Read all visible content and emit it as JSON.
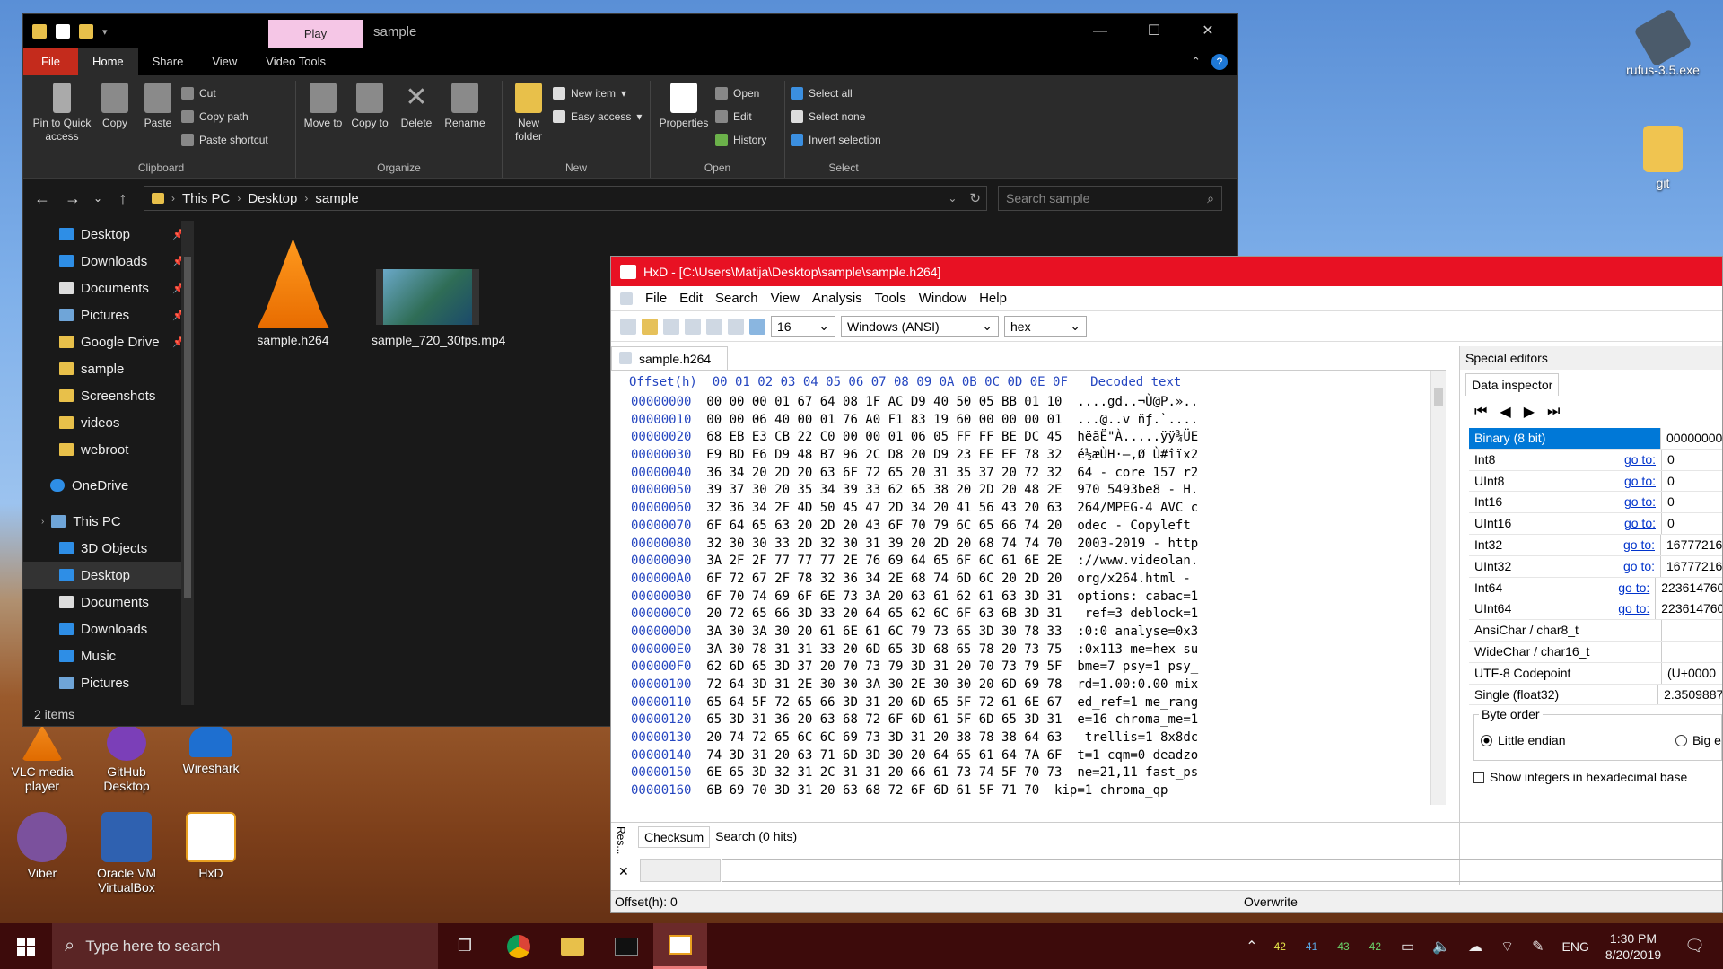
{
  "desktop": {
    "icons_left": [
      {
        "label": "VLC media player"
      },
      {
        "label": "GitHub Desktop"
      },
      {
        "label": "Wireshark"
      },
      {
        "label": "Viber"
      },
      {
        "label": "Oracle VM VirtualBox"
      },
      {
        "label": "HxD"
      }
    ],
    "icons_right": [
      {
        "label": "rufus-3.5.exe"
      },
      {
        "label": "git"
      }
    ]
  },
  "explorer": {
    "contextual_tab": "Play",
    "title": "sample",
    "tabs": [
      "File",
      "Home",
      "Share",
      "View",
      "Video Tools"
    ],
    "ribbon": {
      "clipboard": {
        "label": "Clipboard",
        "pin": "Pin to Quick access",
        "copy": "Copy",
        "paste": "Paste",
        "cut": "Cut",
        "copy_path": "Copy path",
        "paste_shortcut": "Paste shortcut"
      },
      "organize": {
        "label": "Organize",
        "move_to": "Move to",
        "copy_to": "Copy to",
        "delete": "Delete",
        "rename": "Rename"
      },
      "new": {
        "label": "New",
        "new_folder": "New folder",
        "new_item": "New item",
        "easy_access": "Easy access"
      },
      "open": {
        "label": "Open",
        "properties": "Properties",
        "open": "Open",
        "edit": "Edit",
        "history": "History"
      },
      "select": {
        "label": "Select",
        "select_all": "Select all",
        "select_none": "Select none",
        "invert": "Invert selection"
      }
    },
    "breadcrumb": [
      "This PC",
      "Desktop",
      "sample"
    ],
    "search_placeholder": "Search sample",
    "nav_items": [
      {
        "label": "Desktop",
        "pinned": true
      },
      {
        "label": "Downloads",
        "pinned": true
      },
      {
        "label": "Documents",
        "pinned": true
      },
      {
        "label": "Pictures",
        "pinned": true
      },
      {
        "label": "Google Drive",
        "pinned": true
      },
      {
        "label": "sample"
      },
      {
        "label": "Screenshots"
      },
      {
        "label": "videos"
      },
      {
        "label": "webroot"
      },
      {
        "label": "OneDrive"
      },
      {
        "label": "This PC"
      },
      {
        "label": "3D Objects"
      },
      {
        "label": "Desktop"
      },
      {
        "label": "Documents"
      },
      {
        "label": "Downloads"
      },
      {
        "label": "Music"
      },
      {
        "label": "Pictures"
      }
    ],
    "files": [
      {
        "name": "sample.h264"
      },
      {
        "name": "sample_720_30fps.mp4"
      }
    ],
    "status": "2 items"
  },
  "hxd": {
    "title": "HxD - [C:\\Users\\Matija\\Desktop\\sample\\sample.h264]",
    "menu": [
      "File",
      "Edit",
      "Search",
      "View",
      "Analysis",
      "Tools",
      "Window",
      "Help"
    ],
    "bytes_per_row": "16",
    "charset": "Windows (ANSI)",
    "display": "hex",
    "doc_tab": "sample.h264",
    "header_offset": "Offset(h)",
    "header_cols": "00 01 02 03 04 05 06 07 08 09 0A 0B 0C 0D 0E 0F",
    "header_decoded": "Decoded text",
    "rows": [
      {
        "off": "00000000",
        "hex": "00 00 00 01 67 64 08 1F AC D9 40 50 05 BB 01 10",
        "txt": "....gd..¬Ù@P.».."
      },
      {
        "off": "00000010",
        "hex": "00 00 06 40 00 01 76 A0 F1 83 19 60 00 00 00 01",
        "txt": "...@..v ñƒ.`...."
      },
      {
        "off": "00000020",
        "hex": "68 EB E3 CB 22 C0 00 00 01 06 05 FF FF BE DC 45",
        "txt": "hëãË\"À.....ÿÿ¾ÜE"
      },
      {
        "off": "00000030",
        "hex": "E9 BD E6 D9 48 B7 96 2C D8 20 D9 23 EE EF 78 32",
        "txt": "é½æÙH·–,Ø Ù#îïx2"
      },
      {
        "off": "00000040",
        "hex": "36 34 20 2D 20 63 6F 72 65 20 31 35 37 20 72 32",
        "txt": "64 - core 157 r2"
      },
      {
        "off": "00000050",
        "hex": "39 37 30 20 35 34 39 33 62 65 38 20 2D 20 48 2E",
        "txt": "970 5493be8 - H."
      },
      {
        "off": "00000060",
        "hex": "32 36 34 2F 4D 50 45 47 2D 34 20 41 56 43 20 63",
        "txt": "264/MPEG-4 AVC c"
      },
      {
        "off": "00000070",
        "hex": "6F 64 65 63 20 2D 20 43 6F 70 79 6C 65 66 74 20",
        "txt": "odec - Copyleft "
      },
      {
        "off": "00000080",
        "hex": "32 30 30 33 2D 32 30 31 39 20 2D 20 68 74 74 70",
        "txt": "2003-2019 - http"
      },
      {
        "off": "00000090",
        "hex": "3A 2F 2F 77 77 77 2E 76 69 64 65 6F 6C 61 6E 2E",
        "txt": "://www.videolan."
      },
      {
        "off": "000000A0",
        "hex": "6F 72 67 2F 78 32 36 34 2E 68 74 6D 6C 20 2D 20",
        "txt": "org/x264.html - "
      },
      {
        "off": "000000B0",
        "hex": "6F 70 74 69 6F 6E 73 3A 20 63 61 62 61 63 3D 31",
        "txt": "options: cabac=1"
      },
      {
        "off": "000000C0",
        "hex": "20 72 65 66 3D 33 20 64 65 62 6C 6F 63 6B 3D 31",
        "txt": " ref=3 deblock=1"
      },
      {
        "off": "000000D0",
        "hex": "3A 30 3A 30 20 61 6E 61 6C 79 73 65 3D 30 78 33",
        "txt": ":0:0 analyse=0x3"
      },
      {
        "off": "000000E0",
        "hex": "3A 30 78 31 31 33 20 6D 65 3D 68 65 78 20 73 75",
        "txt": ":0x113 me=hex su"
      },
      {
        "off": "000000F0",
        "hex": "62 6D 65 3D 37 20 70 73 79 3D 31 20 70 73 79 5F",
        "txt": "bme=7 psy=1 psy_"
      },
      {
        "off": "00000100",
        "hex": "72 64 3D 31 2E 30 30 3A 30 2E 30 30 20 6D 69 78",
        "txt": "rd=1.00:0.00 mix"
      },
      {
        "off": "00000110",
        "hex": "65 64 5F 72 65 66 3D 31 20 6D 65 5F 72 61 6E 67",
        "txt": "ed_ref=1 me_rang"
      },
      {
        "off": "00000120",
        "hex": "65 3D 31 36 20 63 68 72 6F 6D 61 5F 6D 65 3D 31",
        "txt": "e=16 chroma_me=1"
      },
      {
        "off": "00000130",
        "hex": "20 74 72 65 6C 6C 69 73 3D 31 20 38 78 38 64 63",
        "txt": " trellis=1 8x8dc"
      },
      {
        "off": "00000140",
        "hex": "74 3D 31 20 63 71 6D 3D 30 20 64 65 61 64 7A 6F",
        "txt": "t=1 cqm=0 deadzo"
      },
      {
        "off": "00000150",
        "hex": "6E 65 3D 32 31 2C 31 31 20 66 61 73 74 5F 70 73",
        "txt": "ne=21,11 fast_ps"
      },
      {
        "off": "00000160",
        "hex": "6B 69 70 3D 31 20 63 68 72 6F 6D 61 5F 71 70",
        "txt": "kip=1 chroma_qp"
      }
    ],
    "special_editors": "Special editors",
    "data_inspector": "Data inspector",
    "go_to": "go to:",
    "inspector": [
      {
        "name": "Binary (8 bit)",
        "value": "00000000",
        "goto": false,
        "selected": true
      },
      {
        "name": "Int8",
        "value": "0",
        "goto": true
      },
      {
        "name": "UInt8",
        "value": "0",
        "goto": true
      },
      {
        "name": "Int16",
        "value": "0",
        "goto": true
      },
      {
        "name": "UInt16",
        "value": "0",
        "goto": true
      },
      {
        "name": "Int32",
        "value": "16777216",
        "goto": true
      },
      {
        "name": "UInt32",
        "value": "16777216",
        "goto": true
      },
      {
        "name": "Int64",
        "value": "223614760",
        "goto": true
      },
      {
        "name": "UInt64",
        "value": "223614760",
        "goto": true
      },
      {
        "name": "AnsiChar / char8_t",
        "value": "",
        "goto": false
      },
      {
        "name": "WideChar / char16_t",
        "value": "",
        "goto": false
      },
      {
        "name": "UTF-8 Codepoint",
        "value": "(U+0000",
        "goto": false
      },
      {
        "name": "Single (float32)",
        "value": "2.3509887",
        "goto": false
      }
    ],
    "byte_order": "Byte order",
    "little_endian": "Little endian",
    "big_endian": "Big e",
    "show_hex": "Show integers in hexadecimal base",
    "bottom_tabs": [
      "Checksum",
      "Search (0 hits)"
    ],
    "results_label": "Res...",
    "status_offset": "Offset(h): 0",
    "status_mode": "Overwrite"
  },
  "taskbar": {
    "search_placeholder": "Type here to search",
    "tray_nums": [
      "42",
      "41",
      "43",
      "42"
    ],
    "language": "ENG",
    "time": "1:30 PM",
    "date": "8/20/2019"
  }
}
